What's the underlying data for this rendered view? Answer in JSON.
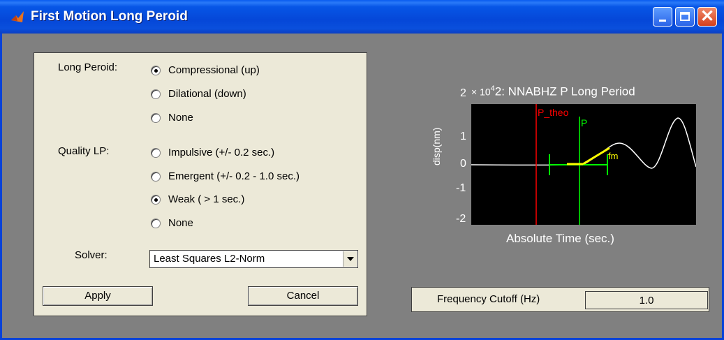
{
  "window": {
    "title": "First Motion Long Peroid",
    "icon": "matlab-icon"
  },
  "controls": {
    "window_buttons": [
      "minimize-icon",
      "maximize-icon",
      "close-icon"
    ]
  },
  "long_period": {
    "label": "Long Peroid:",
    "options": [
      "Compressional (up)",
      "Dilational (down)",
      "None"
    ],
    "selected": "Compressional (up)"
  },
  "quality": {
    "label": "Quality LP:",
    "options": [
      "Impulsive (+/- 0.2 sec.)",
      "Emergent (+/- 0.2 - 1.0 sec.)",
      "Weak ( > 1 sec.)",
      "None"
    ],
    "selected": "Weak ( > 1 sec.)"
  },
  "solver": {
    "label": "Solver:",
    "value": "Least Squares L2-Norm"
  },
  "buttons": {
    "apply": "Apply",
    "cancel": "Cancel"
  },
  "plot": {
    "scale_prefix": "× 10",
    "scale_exp": "4",
    "title": "2: NNABHZ P Long Period",
    "xlabel": "Absolute Time (sec.)",
    "ylabel": "disp(nm)",
    "yticks": [
      "2",
      "1",
      "0",
      "-1",
      "-2"
    ],
    "markers": {
      "theo": "P_theo",
      "pick": "P",
      "fm": "fm"
    },
    "colors": {
      "background": "#000000",
      "trace": "#ffffff",
      "theo": "#ff0000",
      "pick": "#00ff00",
      "fm": "#ffff00"
    }
  },
  "frequency": {
    "label": "Frequency Cutoff (Hz)",
    "value": "1.0"
  }
}
